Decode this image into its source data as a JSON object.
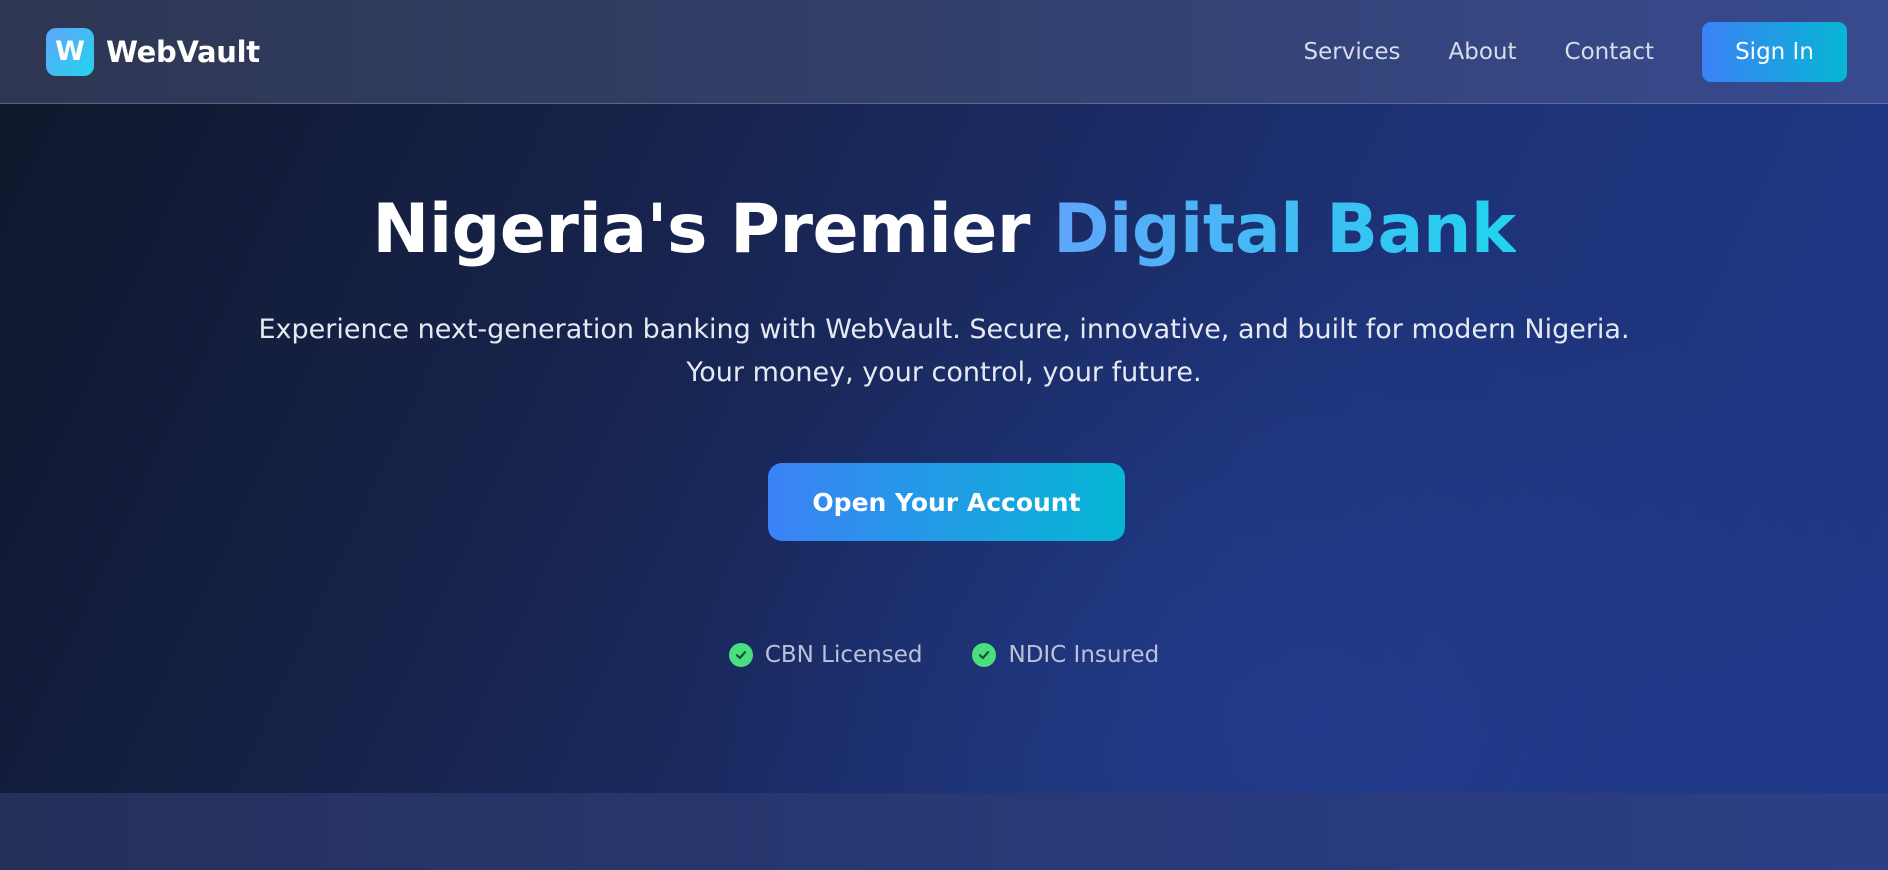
{
  "brand": {
    "logo_letter": "W",
    "name": "WebVault"
  },
  "nav": {
    "items": [
      {
        "label": "Services"
      },
      {
        "label": "About"
      },
      {
        "label": "Contact"
      }
    ],
    "signin_label": "Sign In"
  },
  "hero": {
    "title_main": "Nigeria's Premier ",
    "title_accent": "Digital Bank",
    "subtitle_line1": "Experience next-generation banking with WebVault. Secure, innovative, and built for modern Nigeria.",
    "subtitle_line2": "Your money, your control, your future.",
    "cta_label": "Open Your Account",
    "badges": [
      {
        "label": "CBN Licensed",
        "icon": "check-circle-icon"
      },
      {
        "label": "NDIC Insured",
        "icon": "check-circle-icon"
      }
    ]
  },
  "colors": {
    "accent_start": "#3b82f6",
    "accent_end": "#06b6d4",
    "check_green": "#4ade80"
  }
}
